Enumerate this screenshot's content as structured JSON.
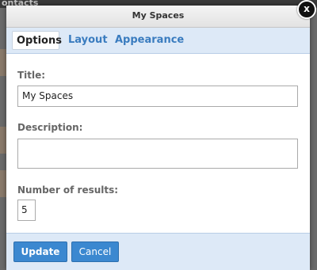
{
  "backdrop": {
    "title": "ontacts"
  },
  "dialog": {
    "title": "My Spaces",
    "close_label": "x"
  },
  "tabs": [
    {
      "label": "Options",
      "active": true
    },
    {
      "label": "Layout",
      "active": false
    },
    {
      "label": "Appearance",
      "active": false
    }
  ],
  "form": {
    "title_label": "Title:",
    "title_value": "My Spaces",
    "description_label": "Description:",
    "description_value": "",
    "num_results_label": "Number of results:",
    "num_results_value": "5"
  },
  "footer": {
    "update_label": "Update",
    "cancel_label": "Cancel"
  },
  "colors": {
    "accent": "#3b88d0",
    "tab_bar": "#dde9f7",
    "tab_text": "#3a7cbf"
  }
}
